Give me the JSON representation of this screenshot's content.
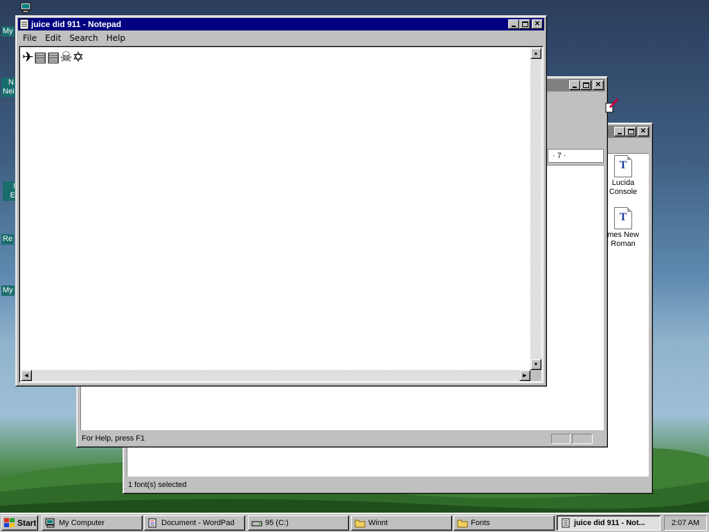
{
  "desktop": {
    "icons": [
      {
        "label": "My",
        "name": "desktop-icon-my-computer"
      },
      {
        "label": "N\nNei",
        "name": "desktop-icon-network"
      },
      {
        "label": "I\nE",
        "name": "desktop-icon-ie"
      },
      {
        "label": "Re",
        "name": "desktop-icon-recycle"
      },
      {
        "label": "My",
        "name": "desktop-icon-my-documents"
      }
    ]
  },
  "notepad": {
    "title": "juice did 911 - Notepad",
    "menu": [
      "File",
      "Edit",
      "Search",
      "Help"
    ],
    "content": "✈▤▤☠✡"
  },
  "wordpad": {
    "status": "For Help, press F1",
    "ruler_text": "· 7 ·"
  },
  "fonts_window": {
    "status": "1 font(s) selected",
    "files": [
      {
        "label": "Lucida\nConsole"
      },
      {
        "label": "mes New\nRoman"
      }
    ]
  },
  "taskbar": {
    "start_label": "Start",
    "buttons": [
      {
        "label": "My Computer",
        "icon": "computer-icon"
      },
      {
        "label": "Document - WordPad",
        "icon": "wordpad-icon"
      },
      {
        "label": "95 (C:)",
        "icon": "drive-icon"
      },
      {
        "label": "Winnt",
        "icon": "folder-icon"
      },
      {
        "label": "Fonts",
        "icon": "folder-icon"
      },
      {
        "label": "juice did 911 - Not...",
        "icon": "notepad-icon"
      }
    ],
    "clock": "2:07 AM"
  },
  "colors": {
    "active_title": "#000080",
    "inactive_title": "#808080",
    "face": "#c0c0c0"
  }
}
